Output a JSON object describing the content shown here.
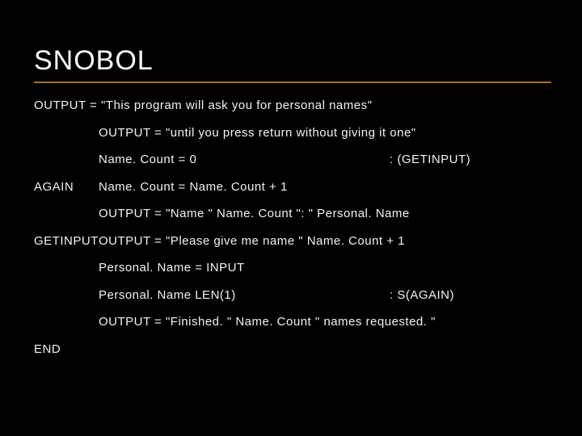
{
  "title": "SNOBOL",
  "lines": [
    {
      "label": "",
      "body": "OUTPUT = \"This program will ask you for personal names\"",
      "goto": "",
      "indent": false
    },
    {
      "label": "",
      "body": "OUTPUT = \"until you press return without giving it one\"",
      "goto": "",
      "indent": true
    },
    {
      "label": "",
      "body": "Name. Count = 0",
      "goto": ": (GETINPUT)",
      "indent": true
    },
    {
      "label": "AGAIN",
      "body": "Name. Count = Name. Count + 1",
      "goto": "",
      "indent": false
    },
    {
      "label": "",
      "body": "OUTPUT = \"Name \" Name. Count \": \" Personal. Name",
      "goto": "",
      "indent": true
    },
    {
      "label": "GETINPUT",
      "body": "OUTPUT = \"Please give me name \" Name. Count + 1",
      "goto": "",
      "indent": false
    },
    {
      "label": "",
      "body": "Personal. Name = INPUT",
      "goto": "",
      "indent": true
    },
    {
      "label": "",
      "body": "Personal. Name LEN(1)",
      "goto": ": S(AGAIN)",
      "indent": true
    },
    {
      "label": "",
      "body": "OUTPUT = \"Finished. \" Name. Count \" names requested. \"",
      "goto": "",
      "indent": true
    },
    {
      "label": "END",
      "body": "",
      "goto": "",
      "indent": false
    }
  ]
}
